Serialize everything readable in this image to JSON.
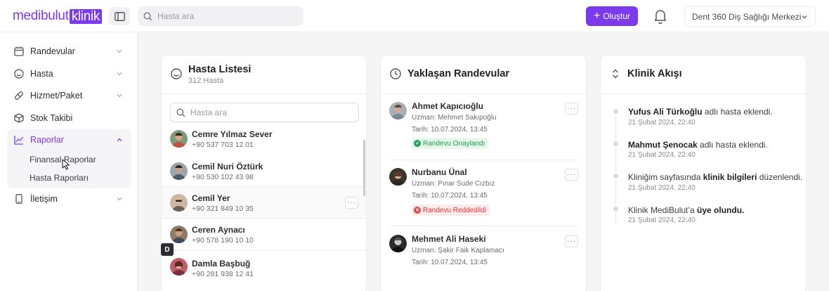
{
  "app": {
    "logo_part1": "medibulut",
    "logo_part2": "klinik",
    "search_placeholder": "Hasta ara",
    "create_label": "Oluştur",
    "clinic_name": "Dent 360 Diş Sağlığı Merkezi"
  },
  "sidebar": {
    "items": [
      {
        "label": "Randevular",
        "icon": "calendar-icon"
      },
      {
        "label": "Hasta",
        "icon": "smile-icon"
      },
      {
        "label": "Hizmet/Paket",
        "icon": "pill-icon"
      },
      {
        "label": "Stok Takibi",
        "icon": "box-icon"
      },
      {
        "label": "Raporlar",
        "icon": "chart-line-icon"
      },
      {
        "label": "İletişim",
        "icon": "phone-icon"
      }
    ],
    "sub_items": [
      "Finansal Raporlar",
      "Hasta Raporları"
    ]
  },
  "patients_panel": {
    "title": "Hasta Listesi",
    "subtitle": "312 Hasta",
    "search_placeholder": "Hasta ara",
    "patients": [
      {
        "name": "Cemre Yılmaz Sever",
        "phone": "+90 537 703 12 01"
      },
      {
        "name": "Cemil Nuri Öztürk",
        "phone": "+90 530 102 43 98"
      },
      {
        "name": "Cemil Yer",
        "phone": "+90 321 849 10 35"
      },
      {
        "name": "Ceren Aynacı",
        "phone": "+90 578 190 10 10"
      },
      {
        "name": "Damla Başbuğ",
        "phone": "+90 281 938 12 41"
      }
    ],
    "index_letter": "D"
  },
  "appointments_panel": {
    "title": "Yaklaşan Randevular",
    "appointments": [
      {
        "name": "Ahmet Kapıcıoğlu",
        "doctor": "Uzman: Mehmet Sakıpoğlu",
        "date": "Tarih: 10.07.2024, 13:45",
        "status": "Randevu Onaylandı",
        "status_type": "ok"
      },
      {
        "name": "Nurbanu Ünal",
        "doctor": "Uzman: Pınar Sude Cızbız",
        "date": "Tarih: 10.07.2024, 13:45",
        "status": "Randevu Reddedildi",
        "status_type": "no"
      },
      {
        "name": "Mehmet Ali Haseki",
        "doctor": "Uzman: Şakir Faik Kaplamacı",
        "date": "Tarih: 10.07.2024, 13:45",
        "status": "",
        "status_type": ""
      }
    ]
  },
  "feed_panel": {
    "title": "Klinik Akışı",
    "events": [
      {
        "bold": "Yufus Ali Türkoğlu",
        "rest": " adlı hasta eklendi.",
        "time": "21 Şubat 2024, 22:40"
      },
      {
        "bold": "Mahmut Şenocak",
        "rest": " adlı hasta eklendi.",
        "time": "21 Şubat 2024, 22:40"
      },
      {
        "pre": "Kliniğim sayfasında ",
        "bold": "klinik bilgileri",
        "rest": " düzenlendi.",
        "time": "21 Şubat 2024, 22:40"
      },
      {
        "pre": "Klinik MediBulut’a ",
        "bold": "üye olundu.",
        "rest": "",
        "time": "21 Şubat 2024, 22:40"
      }
    ]
  },
  "colors": {
    "accent": "#7c3aed",
    "ok": "#22a557",
    "no": "#e04848"
  }
}
